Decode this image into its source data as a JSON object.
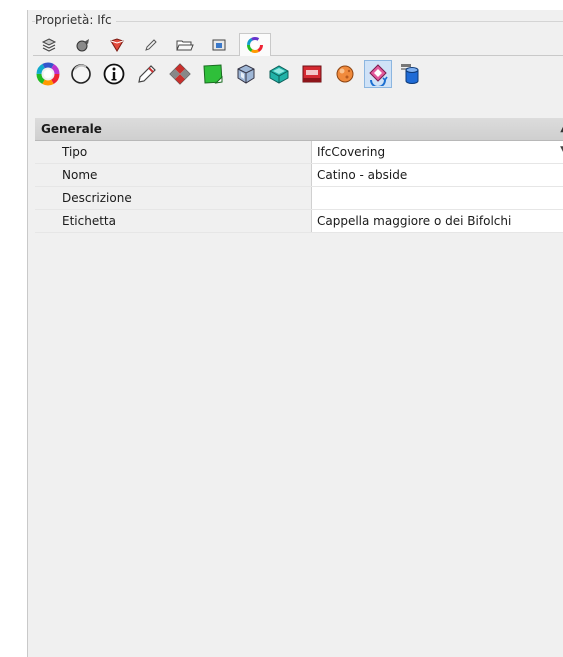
{
  "panel": {
    "title": "Proprietà: Ifc"
  },
  "tabs": [
    {
      "icon": "layers-icon"
    },
    {
      "icon": "object-icon"
    },
    {
      "icon": "material-icon"
    },
    {
      "icon": "pencil-icon"
    },
    {
      "icon": "folder-icon"
    },
    {
      "icon": "viewport-icon"
    },
    {
      "icon": "color-wheel-icon",
      "active": true
    }
  ],
  "toolbar_icons": [
    {
      "icon": "color-wheel-icon"
    },
    {
      "icon": "circle-outline-icon"
    },
    {
      "icon": "info-icon"
    },
    {
      "icon": "pencil-icon"
    },
    {
      "icon": "checker-icon"
    },
    {
      "icon": "green-square-icon"
    },
    {
      "icon": "cube-icon"
    },
    {
      "icon": "teal-box-icon"
    },
    {
      "icon": "red-box-icon"
    },
    {
      "icon": "ball-icon"
    },
    {
      "icon": "cycle-arrows-icon",
      "selected": true
    },
    {
      "icon": "cylinder-icon"
    }
  ],
  "section": {
    "title": "Generale"
  },
  "properties": [
    {
      "name": "Tipo",
      "value": "IfcCovering"
    },
    {
      "name": "Nome",
      "value": "Catino - abside"
    },
    {
      "name": "Descrizione",
      "value": ""
    },
    {
      "name": "Etichetta",
      "value": "Cappella maggiore o dei Bifolchi"
    }
  ]
}
